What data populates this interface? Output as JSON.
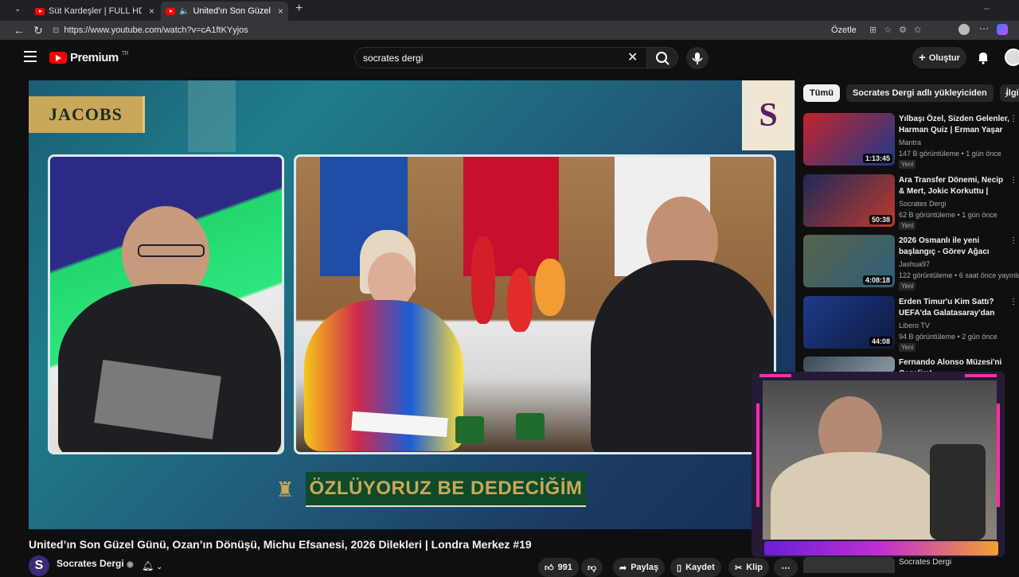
{
  "browser": {
    "tabs": [
      {
        "title": "Süt Kardeşler | FULL HD - YouTube",
        "active": false
      },
      {
        "title": "United'ın Son Güzel Günü, O:",
        "active": true
      }
    ],
    "url": "https://www.youtube.com/watch?v=cA1ftKYyjos",
    "summarize_label": "Özetle"
  },
  "youtube": {
    "logo_text": "Premium",
    "logo_region": "TR",
    "search_value": "socrates dergi",
    "create_label": "Oluştur"
  },
  "video": {
    "sponsor_logo": "JACOBS",
    "banner_text": "ÖZLÜYORUZ BE DEDECİĞİM",
    "channel_badge": "S",
    "title": "United’ın Son Güzel Günü, Ozan’ın Dönüşü, Michu Efsanesi, 2026 Dilekleri | Londra Merkez #19",
    "channel_name": "Socrates Dergi",
    "likes": "991",
    "share_label": "Paylaş",
    "save_label": "Kaydet",
    "clip_label": "Klip"
  },
  "sidebar": {
    "chips": [
      "Tümü",
      "Socrates Dergi adlı yükleyiciden",
      "İlgili"
    ],
    "recommendations": [
      {
        "title": "Yılbaşı Özel, Sizden Gelenler, Harman Quiz | Erman Yaşar & ...",
        "channel": "Mantra",
        "meta": "147 B görüntüleme • 1 gün önce",
        "badge": "Yeni",
        "duration": "1:13:45",
        "thumb_color": "#b8232a"
      },
      {
        "title": "Ara Transfer Dönemi, Necip & Mert, Jokic Korkuttu | Mehmet...",
        "channel": "Socrates Dergi",
        "meta": "62 B görüntüleme • 1 gün önce",
        "badge": "Yeni",
        "duration": "50:38",
        "thumb_color": "#1c2a5a"
      },
      {
        "title": "2026 Osmanlı ile yeni başlangıç - Görev Ağacı tamamlamaca",
        "channel": "Jashua97",
        "meta": "122 görüntüleme • 6 saat önce yayınlandı",
        "badge": "Yeni",
        "duration": "4:08:18",
        "thumb_color": "#5e6a4e"
      },
      {
        "title": "Erden Timur'u Kim Sattı? UEFA'da Galatasaray'dan Daha...",
        "channel": "Libero TV",
        "meta": "94 B görüntüleme • 2 gün önce",
        "badge": "Yeni",
        "duration": "44:08",
        "thumb_color": "#1e3b8a"
      },
      {
        "title": "Fernando Alonso Müzesi'ni Gezelim!",
        "channel": "",
        "meta": "",
        "badge": "",
        "duration": "",
        "thumb_color": "#3a4a55"
      }
    ],
    "bottom_channel": "Socrates Dergi"
  }
}
